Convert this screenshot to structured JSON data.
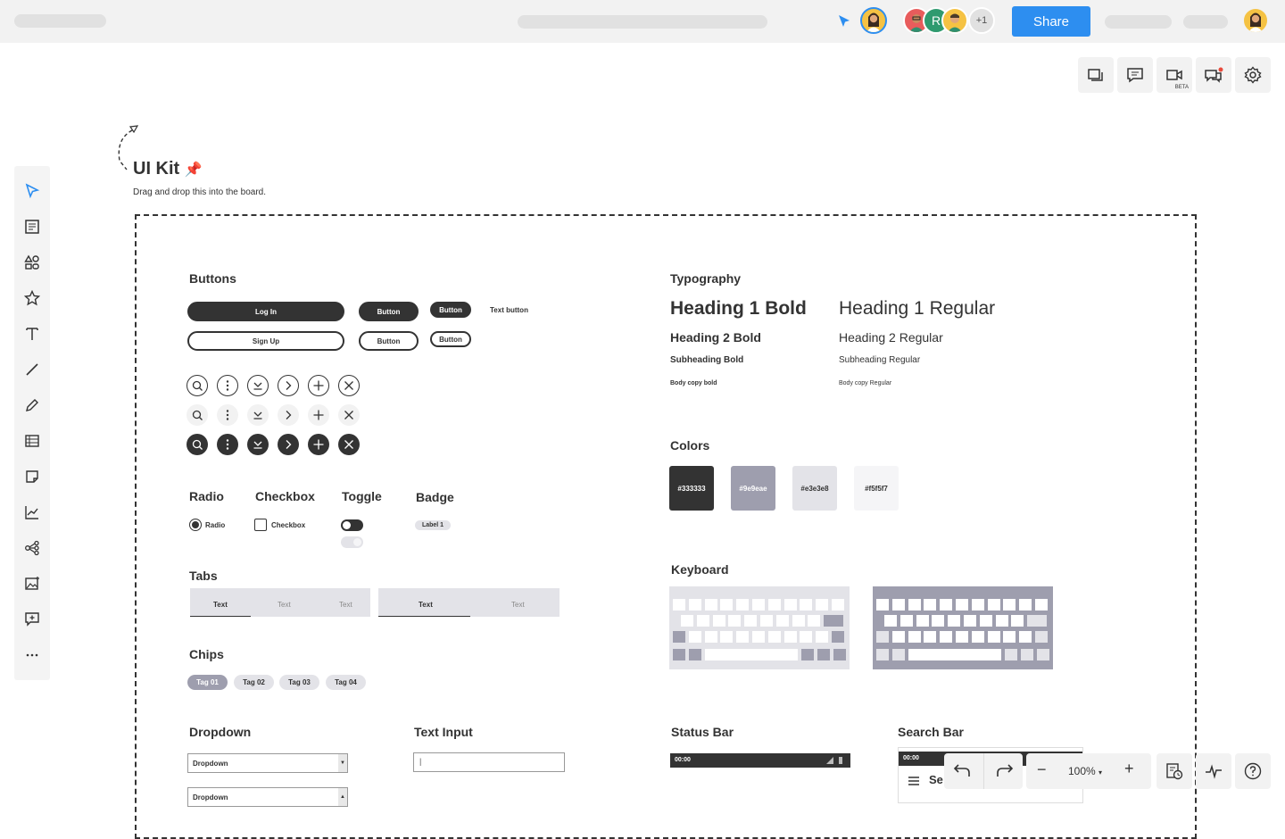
{
  "topbar": {
    "share_label": "Share",
    "collab_initial": "R",
    "more_count": "+1"
  },
  "header": {
    "title": "UI Kit",
    "title_emoji": "📌",
    "subtitle": "Drag and drop this into the board."
  },
  "toolbar": {
    "video_badge": "BETA"
  },
  "sections": {
    "buttons": "Buttons",
    "typography": "Typography",
    "colors": "Colors",
    "radio": "Radio",
    "checkbox": "Checkbox",
    "toggle": "Toggle",
    "badge": "Badge",
    "tabs": "Tabs",
    "keyboard": "Keyboard",
    "chips": "Chips",
    "dropdown": "Dropdown",
    "text_input": "Text Input",
    "status_bar": "Status Bar",
    "search_bar": "Search Bar"
  },
  "buttons": {
    "login": "Log In",
    "signup": "Sign Up",
    "button": "Button",
    "text_button": "Text button"
  },
  "typography": {
    "h1_bold": "Heading 1 Bold",
    "h1_regular": "Heading 1 Regular",
    "h2_bold": "Heading 2 Bold",
    "h2_regular": "Heading 2 Regular",
    "sub_bold": "Subheading Bold",
    "sub_regular": "Subheading Regular",
    "body_bold": "Body copy bold",
    "body_regular": "Body copy Regular"
  },
  "colors": [
    {
      "label": "#333333",
      "hex": "#333333",
      "text": "#ffffff"
    },
    {
      "label": "#9e9eae",
      "hex": "#9e9eae",
      "text": "#ffffff"
    },
    {
      "label": "#e3e3e8",
      "hex": "#e3e3e8",
      "text": "#333333"
    },
    {
      "label": "#f5f5f7",
      "hex": "#f5f5f7",
      "text": "#333333"
    }
  ],
  "controls": {
    "radio_label": "Radio",
    "checkbox_label": "Checkbox",
    "badge_label": "Label 1"
  },
  "tabs": {
    "group1": [
      "Text",
      "Text",
      "Text"
    ],
    "group2": [
      "Text",
      "Text"
    ]
  },
  "chips": [
    "Tag 01",
    "Tag 02",
    "Tag 03",
    "Tag 04"
  ],
  "dropdown": {
    "label": "Dropdown",
    "down_arrow": "▼",
    "up_arrow": "▲"
  },
  "text_input": {
    "cursor": "|"
  },
  "status_bar": {
    "time": "00:00"
  },
  "search_bar": {
    "time": "00:00",
    "partial_text": "Se"
  },
  "bottom": {
    "zoom": "100%",
    "minus": "−",
    "plus": "+"
  }
}
